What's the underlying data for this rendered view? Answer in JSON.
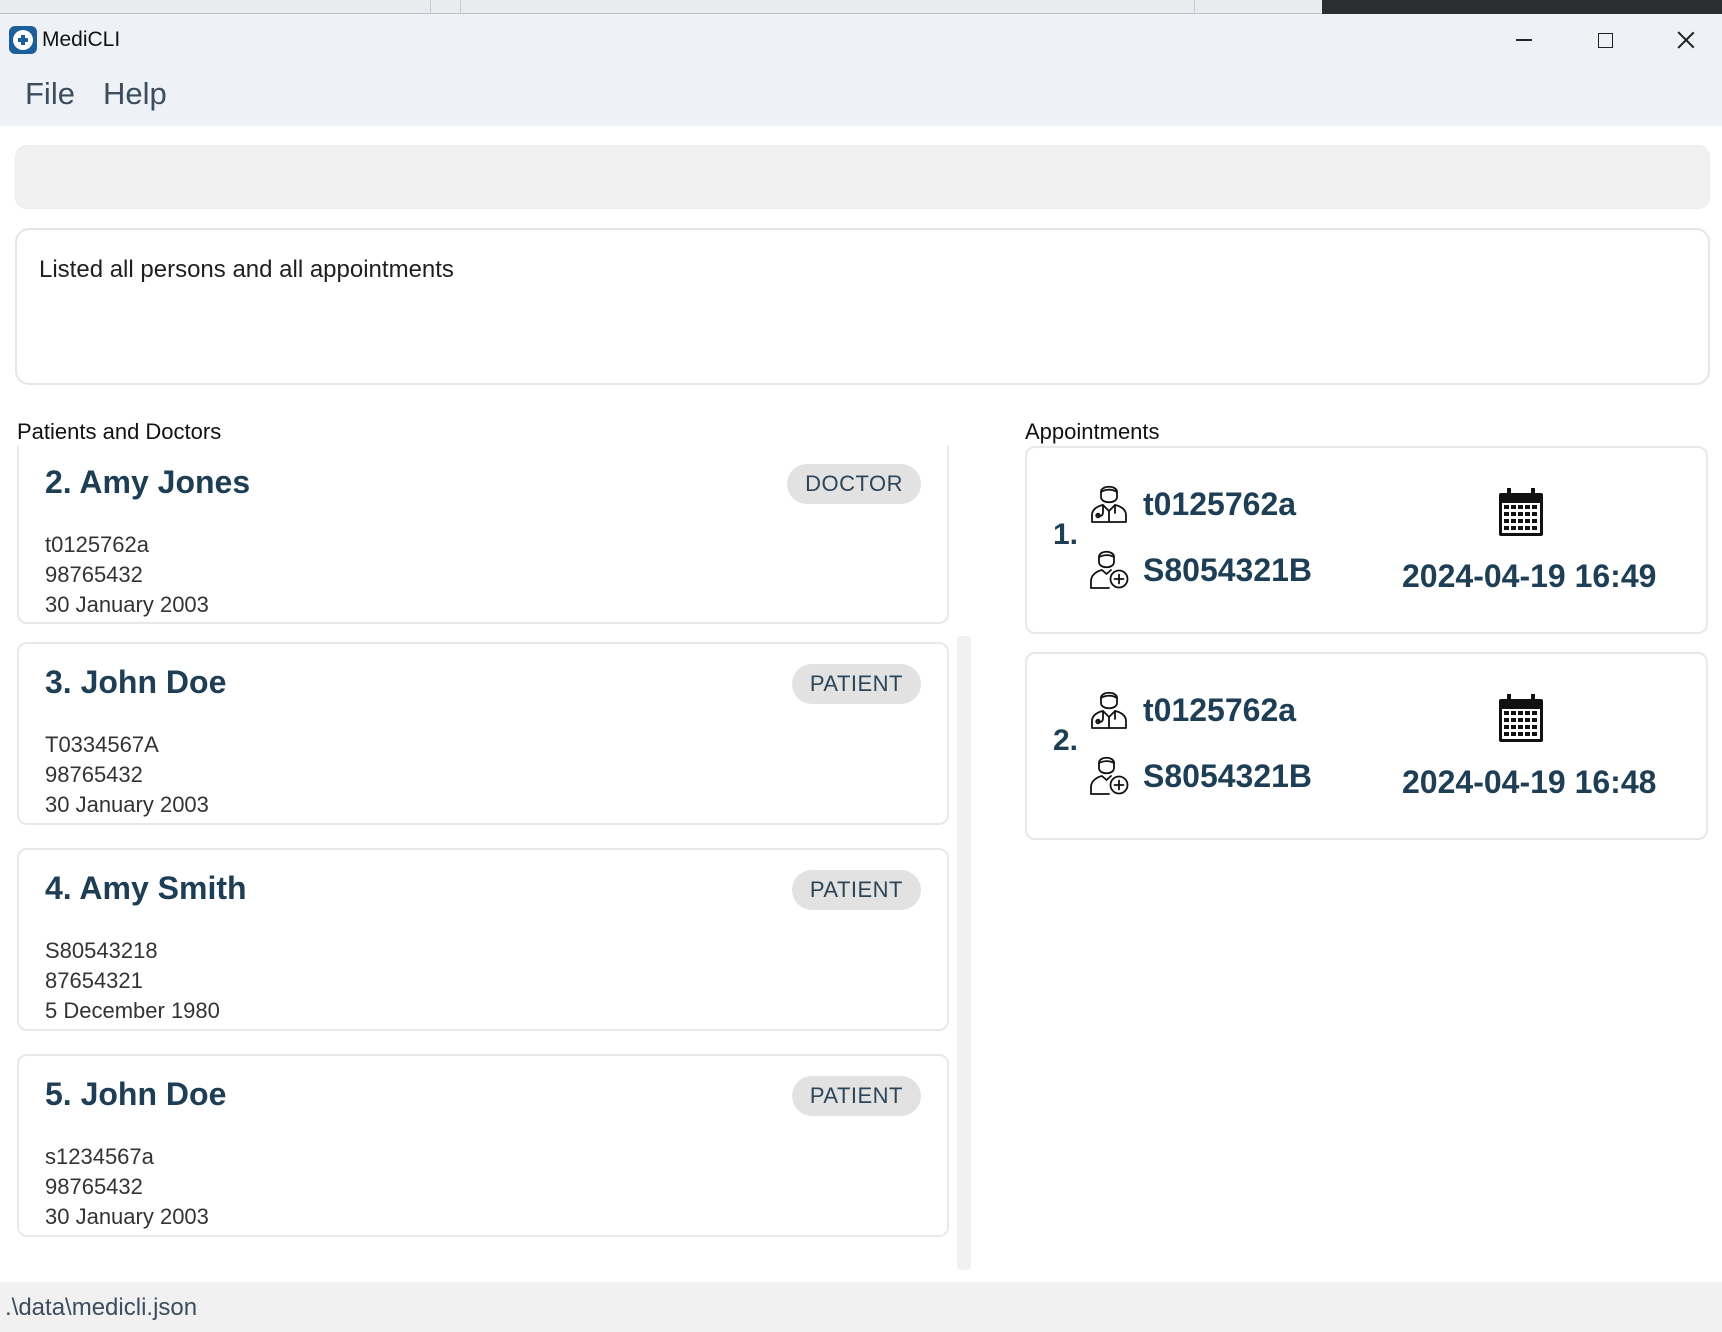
{
  "app": {
    "title": "MediCLI"
  },
  "menu": {
    "file": "File",
    "help": "Help"
  },
  "command": {
    "value": ""
  },
  "result": {
    "text": "Listed all persons and all appointments"
  },
  "sections": {
    "persons": "Patients and Doctors",
    "appointments": "Appointments"
  },
  "persons": [
    {
      "name": "2.  Amy Jones",
      "role": "DOCTOR",
      "nric": "t0125762a",
      "phone": "98765432",
      "dob": "30 January 2003"
    },
    {
      "name": "3.  John Doe",
      "role": "PATIENT",
      "nric": "T0334567A",
      "phone": "98765432",
      "dob": "30 January 2003"
    },
    {
      "name": "4.  Amy Smith",
      "role": "PATIENT",
      "nric": "S80543218",
      "phone": "87654321",
      "dob": "5 December 1980"
    },
    {
      "name": "5.  John Doe",
      "role": "PATIENT",
      "nric": "s1234567a",
      "phone": "98765432",
      "dob": "30 January 2003"
    }
  ],
  "appointments": [
    {
      "index": "1.",
      "doctor": "t0125762a",
      "patient": "S8054321B",
      "datetime": "2024-04-19 16:49"
    },
    {
      "index": "2.",
      "doctor": "t0125762a",
      "patient": "S8054321B",
      "datetime": "2024-04-19 16:48"
    }
  ],
  "status": {
    "path": ".\\data\\medicli.json"
  },
  "icons": {
    "app": "medical-cross-icon",
    "doctor": "doctor-icon",
    "patient": "patient-icon",
    "calendar": "calendar-icon"
  },
  "colors": {
    "accent": "#1d3e54",
    "badge_bg": "#e2e2e2",
    "titlebar": "#eef2f6"
  }
}
